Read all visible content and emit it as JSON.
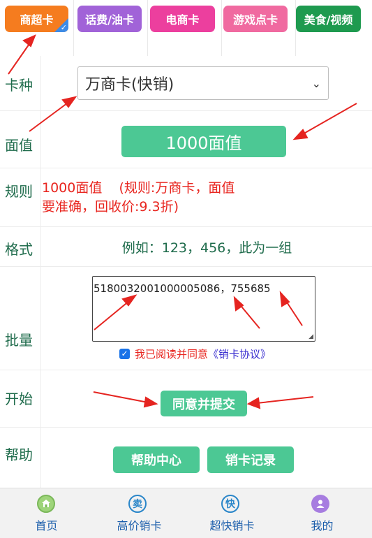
{
  "tabs": [
    {
      "label": "商超卡",
      "color": "#f57c1f",
      "selected": true
    },
    {
      "label": "话费/油卡",
      "color": "#a163d8"
    },
    {
      "label": "电商卡",
      "color": "#ec3f9e"
    },
    {
      "label": "游戏点卡",
      "color": "#f06aa0"
    },
    {
      "label": "美食/视频",
      "color": "#1e9a4f"
    }
  ],
  "form": {
    "card_type_label": "卡种",
    "card_type_value": "万商卡(快销)",
    "face_value_label": "面值",
    "face_value_button": "1000面值",
    "rule_label": "规则",
    "rule_line1": "1000面值    (规则:万商卡，面值",
    "rule_line2": "要准确，回收价:9.3折)",
    "format_label": "格式",
    "format_text": "例如：123，456，此为一组",
    "batch_label": "批量",
    "batch_value": "5180032001000005086，755685",
    "agree_text": "我已阅读并同意",
    "agree_link": "《销卡协议》",
    "start_label": "开始",
    "submit_button": "同意并提交",
    "help_label": "帮助",
    "help_center_button": "帮助中心",
    "records_button": "销卡记录"
  },
  "bottom_nav": [
    {
      "label": "首页",
      "icon": "home-icon"
    },
    {
      "label": "高价销卡",
      "icon": "sell-icon",
      "glyph": "卖"
    },
    {
      "label": "超快销卡",
      "icon": "fast-icon",
      "glyph": "快"
    },
    {
      "label": "我的",
      "icon": "user-icon"
    }
  ],
  "colors": {
    "accent_green": "#4cc894",
    "label_green": "#1e6b4b",
    "rule_red": "#e8251f",
    "nav_blue": "#1a5dab"
  }
}
